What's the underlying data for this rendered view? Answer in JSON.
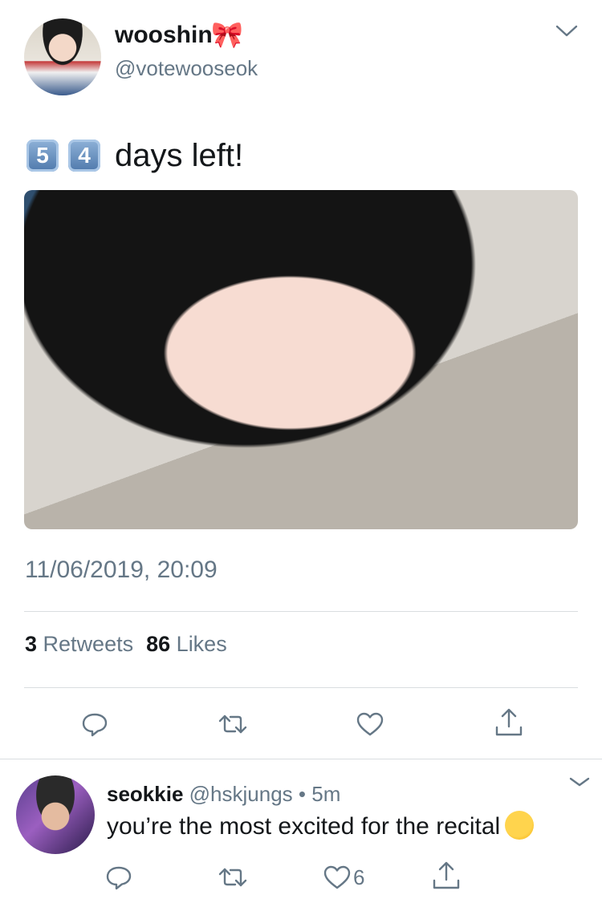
{
  "tweet": {
    "author": {
      "display_name": "wooshin",
      "name_emoji": "🎀",
      "handle": "@votewooseok"
    },
    "text": {
      "digit_1": "5",
      "digit_2": "4",
      "rest": "days left!"
    },
    "timestamp": "11/06/2019, 20:09",
    "stats": {
      "retweets_count": "3",
      "retweets_label": "Retweets",
      "likes_count": "86",
      "likes_label": "Likes"
    },
    "actions": [
      "reply-icon",
      "retweet-icon",
      "heart-icon",
      "share-icon"
    ]
  },
  "reply": {
    "display_name": "seokkie",
    "handle": "@hskjungs",
    "separator": "•",
    "time": "5m",
    "text": "you’re the most excited for the recital",
    "emoji": "sneezing-face",
    "like_count": "6",
    "actions": [
      "reply-icon",
      "retweet-icon",
      "heart-icon",
      "share-icon"
    ]
  },
  "colors": {
    "primary_text": "#14171a",
    "secondary_text": "#657786",
    "divider": "#d9dde0",
    "bow": "#f08aa8"
  }
}
